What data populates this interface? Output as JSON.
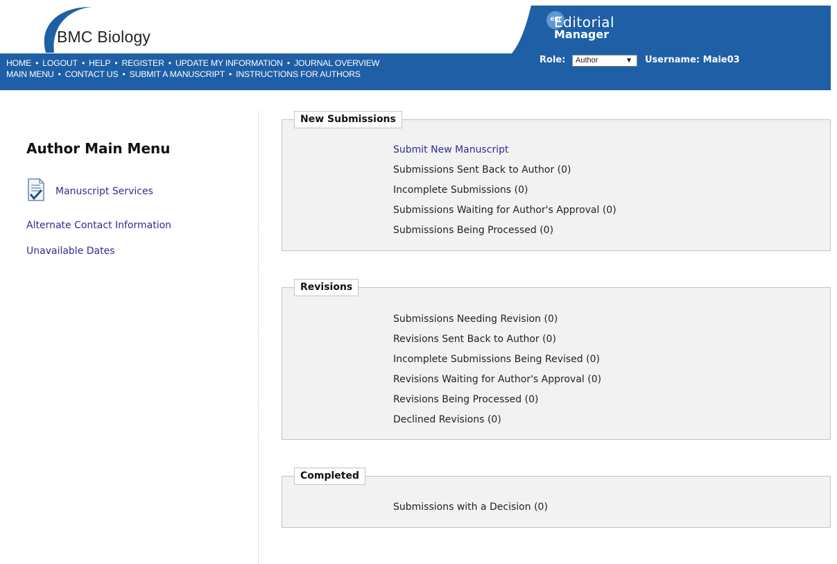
{
  "header": {
    "journal_name": "BMC Biology",
    "nav_row1": [
      "HOME",
      "LOGOUT",
      "HELP",
      "REGISTER",
      "UPDATE MY INFORMATION",
      "JOURNAL OVERVIEW"
    ],
    "nav_row2": [
      "MAIN MENU",
      "CONTACT US",
      "SUBMIT A MANUSCRIPT",
      "INSTRUCTIONS FOR AUTHORS"
    ],
    "em_badge": "em",
    "em_title_line1": "Editorial",
    "em_title_line2": "Manager",
    "role_label": "Role:",
    "role_value": "Author",
    "username_label": "Username: Maie03"
  },
  "colors": {
    "header_blue": "#1f5fa6",
    "link_blue": "#2e2c92",
    "panel_bg": "#f2f2f2"
  },
  "sidebar": {
    "title": "Author Main Menu",
    "icon": "document-checkmark-icon",
    "links": {
      "manuscript_services": "Manuscript Services",
      "alternate_contact": "Alternate Contact Information",
      "unavailable_dates": "Unavailable Dates"
    }
  },
  "panels": {
    "new_submissions": {
      "legend": "New Submissions",
      "items": [
        {
          "label": "Submit New Manuscript"
        },
        {
          "label": "Submissions Sent Back to Author (0)"
        },
        {
          "label": "Incomplete Submissions (0)"
        },
        {
          "label": "Submissions Waiting for Author's Approval (0)"
        },
        {
          "label": "Submissions Being Processed (0)"
        }
      ]
    },
    "revisions": {
      "legend": "Revisions",
      "items": [
        {
          "label": "Submissions Needing Revision (0)"
        },
        {
          "label": "Revisions Sent Back to Author (0)"
        },
        {
          "label": "Incomplete Submissions Being Revised (0)"
        },
        {
          "label": "Revisions Waiting for Author's Approval (0)"
        },
        {
          "label": "Revisions Being Processed  (0)"
        },
        {
          "label": "Declined Revisions (0)"
        }
      ]
    },
    "completed": {
      "legend": "Completed",
      "items": [
        {
          "label": "Submissions with a Decision (0)"
        }
      ]
    }
  }
}
